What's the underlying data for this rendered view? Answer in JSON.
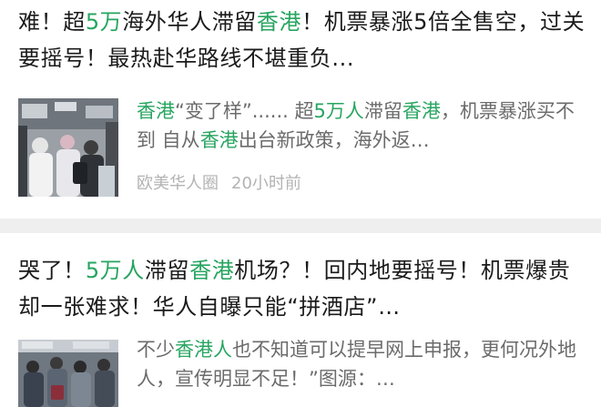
{
  "articles": [
    {
      "title": {
        "p1": "难！超",
        "h1": "5万",
        "p2": "海外华人滞留",
        "h2": "香港",
        "p3": "！机票暴涨5倍全售空，过关要摇号！最热赴华路线不堪重负..."
      },
      "summary": {
        "h1": "香港",
        "p1": "“变了样”...... 超",
        "h2": "5万人",
        "p2": "滞留",
        "h3": "香港",
        "p3": "，机票暴涨买不到 自从",
        "h4": "香港",
        "p4": "出台新政策，海外返…"
      },
      "source": "欧美华人圈",
      "time": "20小时前",
      "thumbnail": "airport-crowd-photo"
    },
    {
      "title": {
        "p1": "哭了！",
        "h1": "5万人",
        "p2": "滞留",
        "h2": "香港",
        "p3": "机场？！回内地要摇号！机票爆贵却一张难求！华人自曝只能“拼酒店”…"
      },
      "summary": {
        "p1": "不少",
        "h1": "香港人",
        "p2": "也不知道可以提早网上申报，更何况外地人，宣传明显不足！”图源：…"
      },
      "thumbnail": "crowd-queue-photo"
    }
  ],
  "colors": {
    "highlight": "#27a560",
    "title": "#1b1b1b",
    "summary": "#6b6b6b",
    "meta": "#b3b3b3",
    "divider": "#efefef"
  }
}
